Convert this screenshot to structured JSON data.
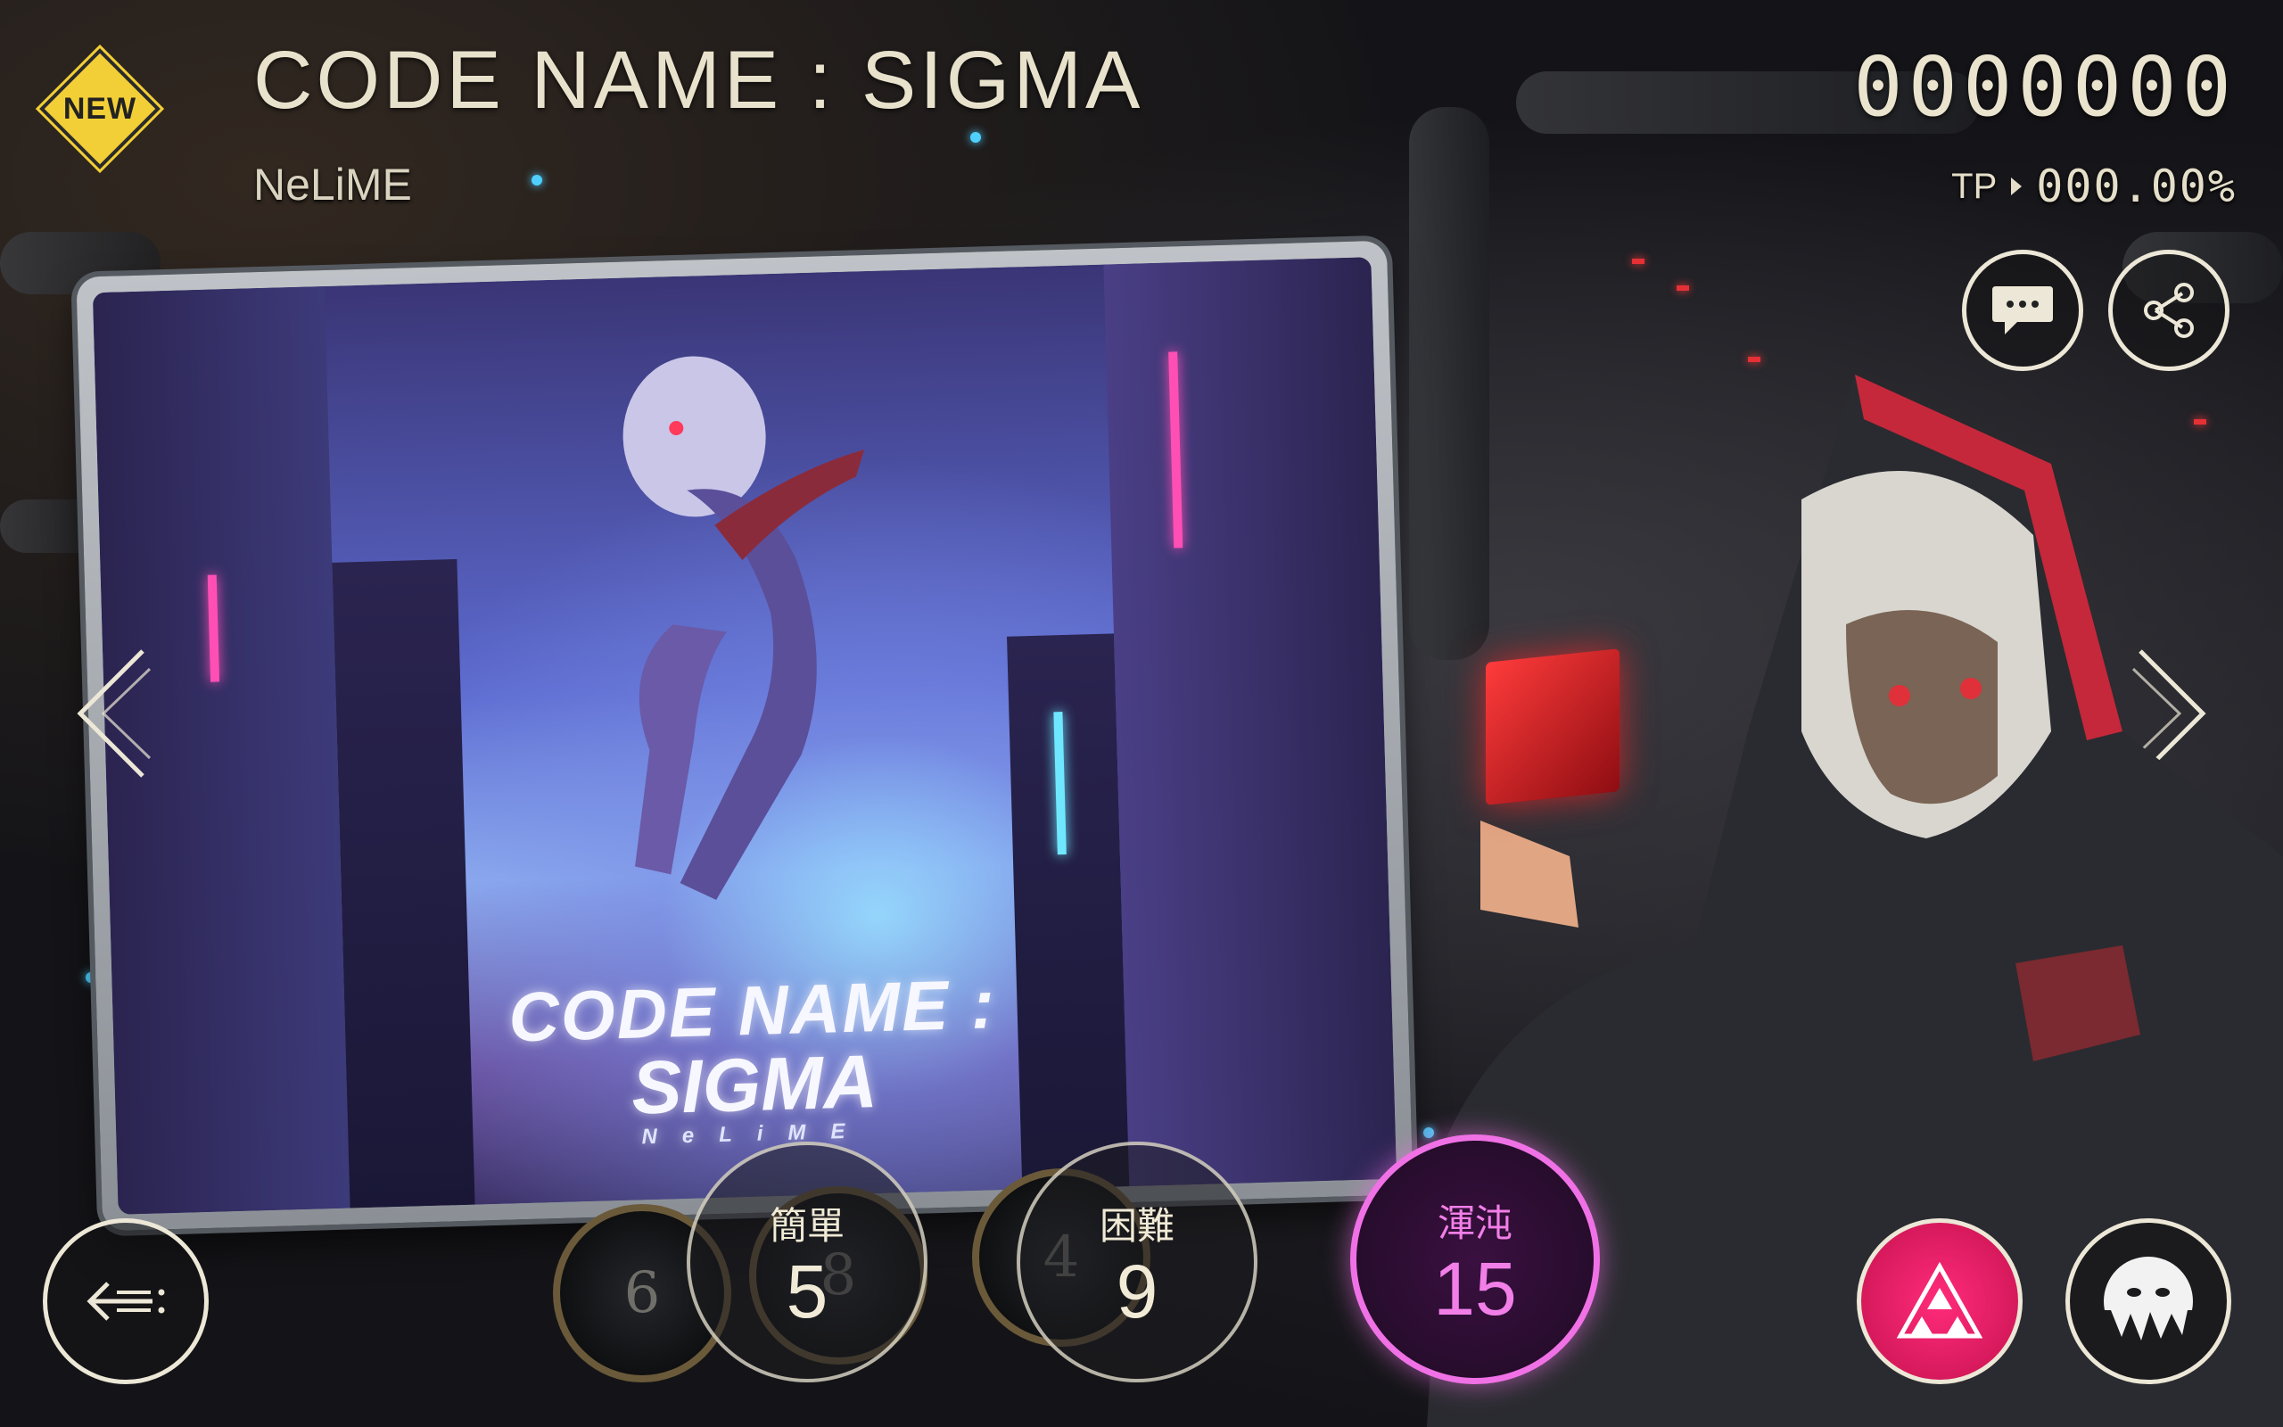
{
  "song": {
    "badge": "NEW",
    "title": "CODE NAME : SIGMA",
    "artist": "NeLiME"
  },
  "score": {
    "value": "0000000",
    "tp_label": "TP",
    "tp_value": "000.00%"
  },
  "cover": {
    "line1": "CODE NAME :",
    "line2": "SIGMA",
    "line3": "NeLiME"
  },
  "difficulties": [
    {
      "name": "簡單",
      "level": "5",
      "selected": false
    },
    {
      "name": "困難",
      "level": "9",
      "selected": false
    },
    {
      "name": "渾沌",
      "level": "15",
      "selected": true
    }
  ],
  "background_dials": [
    "6",
    "8",
    "4"
  ],
  "icons": {
    "comment": "chat-bubble-icon",
    "share": "share-icon",
    "back": "back-arrow-icon",
    "mode": "triangle-mode-icon",
    "character": "character-avatar-icon",
    "prev": "chevron-left-icon",
    "next": "chevron-right-icon"
  },
  "colors": {
    "text": "#e8e2cc",
    "badge": "#f3cf37",
    "chaos": "#f071e6",
    "mode_button": "#e0206a"
  }
}
